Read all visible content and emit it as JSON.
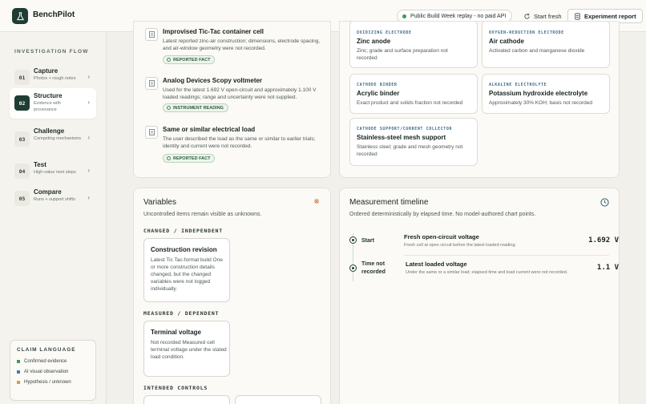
{
  "app": {
    "title": "BenchPilot"
  },
  "header": {
    "status_pill": "Public Build Week replay - no paid API",
    "start_fresh": "Start fresh",
    "experiment_report": "Experiment report"
  },
  "sidebar": {
    "flow_title": "INVESTIGATION FLOW",
    "steps": [
      {
        "num": "01",
        "name": "Capture",
        "sub": "Photos + rough notes"
      },
      {
        "num": "02",
        "name": "Structure",
        "sub": "Evidence with provenance"
      },
      {
        "num": "03",
        "name": "Challenge",
        "sub": "Competing mechanisms"
      },
      {
        "num": "04",
        "name": "Test",
        "sub": "High-value next steps"
      },
      {
        "num": "05",
        "name": "Compare",
        "sub": "Runs + support shifts"
      }
    ],
    "claim_language": {
      "title": "CLAIM LANGUAGE",
      "items": [
        {
          "label": "Confirmed evidence",
          "color": "#3f9b57"
        },
        {
          "label": "AI visual observation",
          "color": "#3c7fb0"
        },
        {
          "label": "Hypothesis / unknown",
          "color": "#d0a045"
        }
      ]
    }
  },
  "evidence": {
    "items": [
      {
        "title": "Improvised Tic-Tac container cell",
        "desc": "Latest reported zinc-air construction; dimensions, electrode spacing, and air-window geometry were not recorded.",
        "tag": "REPORTED FACT"
      },
      {
        "title": "Analog Devices Scopy voltmeter",
        "desc": "Used for the latest 1.692 V open-circuit and approximately 1.100 V loaded readings; range and uncertainty were not supplied.",
        "tag": "INSTRUMENT READING"
      },
      {
        "title": "Same or similar electrical load",
        "desc": "The user described the load as the same or similar to earlier trials; identity and current were not recorded.",
        "tag": "REPORTED FACT"
      }
    ]
  },
  "components": {
    "cards": [
      {
        "label": "OXIDIZING ELECTRODE",
        "title": "Zinc anode",
        "desc": "Zinc; grade and surface preparation not recorded"
      },
      {
        "label": "OXYGEN-REDUCTION ELECTRODE",
        "title": "Air cathode",
        "desc": "Activated carbon and manganese dioxide"
      },
      {
        "label": "CATHODE BINDER",
        "title": "Acrylic binder",
        "desc": "Exact product and solids fraction not recorded"
      },
      {
        "label": "ALKALINE ELECTROLYTE",
        "title": "Potassium hydroxide electrolyte",
        "desc": "Approximately 30% KOH; basis not recorded"
      },
      {
        "label": "CATHODE SUPPORT/CURRENT COLLECTOR",
        "title": "Stainless-steel mesh support",
        "desc": "Stainless steel; grade and mesh geometry not recorded"
      }
    ]
  },
  "variables": {
    "title": "Variables",
    "subtitle": "Uncontrolled items remain visible as unknowns.",
    "changed_label": "CHANGED / INDEPENDENT",
    "changed": {
      "title": "Construction revision",
      "desc": "Latest Tic Tac-format build One or more construction details changed, but the changed variables were not logged individually."
    },
    "measured_label": "MEASURED / DEPENDENT",
    "measured": {
      "title": "Terminal voltage",
      "desc": "Not recorded Measured cell terminal voltage under the stated load condition."
    },
    "controls_label": "INTENDED CONTROLS"
  },
  "timeline": {
    "title": "Measurement timeline",
    "subtitle": "Ordered deterministically by elapsed time. No model-authored chart points.",
    "rows": [
      {
        "when": "Start",
        "name": "Fresh open-circuit voltage",
        "desc": "Fresh cell at open circuit before the latest loaded reading.",
        "value": "1.692 V"
      },
      {
        "when": "Time not recorded",
        "name": "Latest loaded voltage",
        "desc": "Under the same or a similar load; elapsed time and load current were not recorded.",
        "value": "1.1 V"
      }
    ]
  },
  "colors": {
    "accent": "#1f3d33",
    "confirmed": "#3f9b57",
    "ai": "#3c7fb0",
    "hypothesis": "#d0a045",
    "warn": "#c8743a"
  }
}
